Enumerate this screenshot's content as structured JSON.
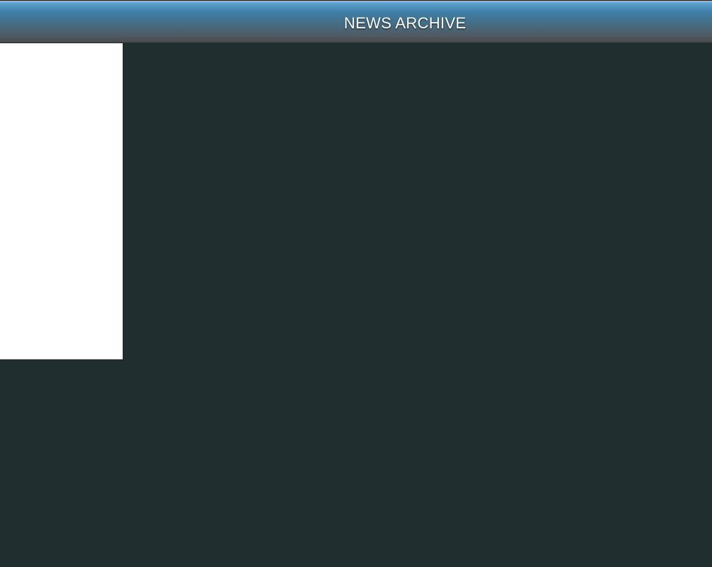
{
  "header": {
    "title": "NEWS ARCHIVE"
  },
  "colors": {
    "background": "#202e2f",
    "header_accent": "#3f7ea6",
    "side_panel": "#ffffff",
    "title_text": "#ffffff"
  }
}
